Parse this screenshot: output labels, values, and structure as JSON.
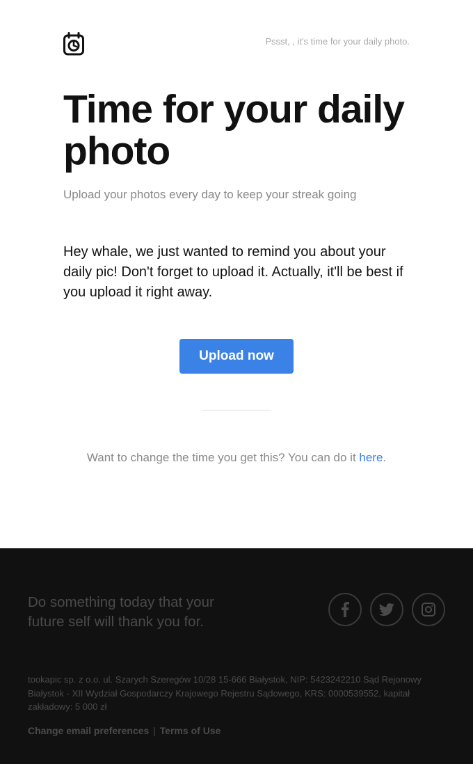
{
  "header": {
    "pssst": "Pssst, , it's time for your daily photo."
  },
  "main": {
    "headline": "Time for your daily photo",
    "subhead": "Upload your photos every day to keep your streak going",
    "body": "Hey whale, we just wanted to remind you about your daily pic! Don't forget to upload it. Actually, it'll be best if you upload it right away.",
    "button_label": "Upload now",
    "change_time_prefix": "Want to change the time you get this? You can do it ",
    "change_time_link": "here",
    "change_time_suffix": "."
  },
  "footer": {
    "tagline": "Do something today that your future self will thank you for.",
    "legal": "tookapic sp. z o.o. ul. Szarych Szeregów 10/28 15-666 Białystok, NIP: 5423242210 Sąd Rejonowy Białystok - XII Wydział Gospodarczy Krajowego Rejestru Sądowego, KRS: 0000539552, kapitał zakładowy: 5 000 zł",
    "link_preferences": "Change email preferences",
    "link_separator": " | ",
    "link_terms": "Terms of Use"
  }
}
